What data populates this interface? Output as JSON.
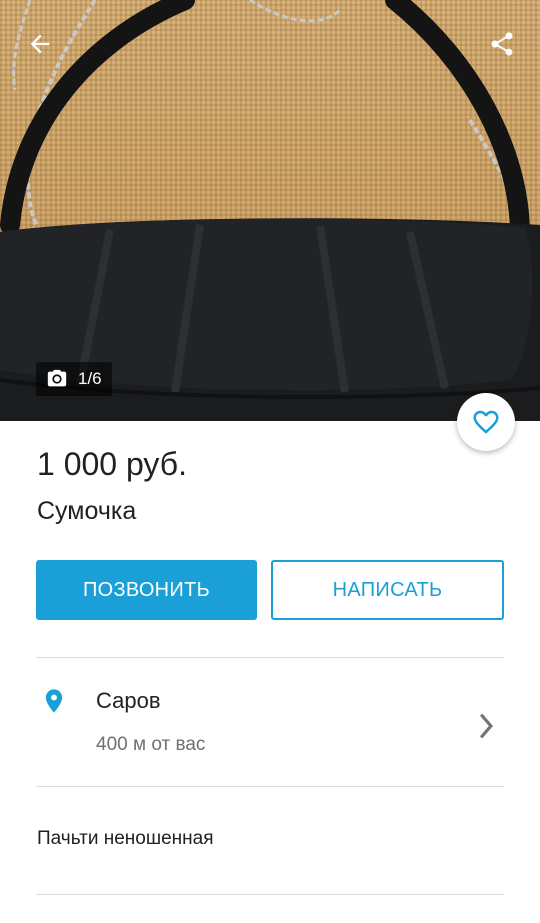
{
  "gallery": {
    "counter": "1/6",
    "icons": {
      "back": "arrow-back-icon",
      "share": "share-icon",
      "camera": "camera-icon",
      "favorite": "heart-outline-icon"
    }
  },
  "listing": {
    "price": "1 000 руб.",
    "title": "Сумочка",
    "description": "Пачьти неношенная"
  },
  "actions": {
    "call_label": "ПОЗВОНИТЬ",
    "write_label": "НАПИСАТЬ"
  },
  "location": {
    "city": "Саров",
    "distance": "400 м от вас",
    "icons": {
      "pin": "location-pin-icon",
      "chevron": "chevron-right-icon"
    }
  },
  "colors": {
    "accent": "#1a9fd7",
    "text": "#212121",
    "secondary_text": "#707070",
    "divider": "#dcdcdc"
  }
}
